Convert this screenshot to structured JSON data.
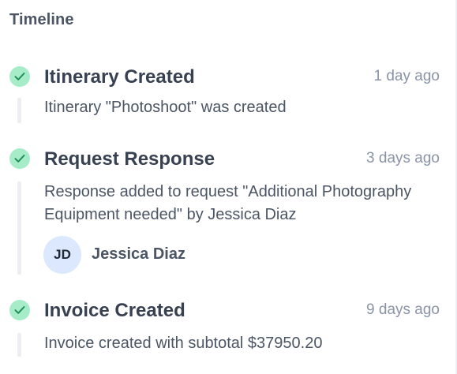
{
  "timeline": {
    "title": "Timeline",
    "status_color": "#a7ecc8",
    "check_color": "#1f8f5a",
    "events": [
      {
        "icon": "check-circle-icon",
        "title": "Itinerary Created",
        "time": "1 day ago",
        "description": "Itinerary \"Photoshoot\" was created"
      },
      {
        "icon": "check-circle-icon",
        "title": "Request Response",
        "time": "3 days ago",
        "description": "Response added to request \"Additional Photography Equipment needed\" by Jessica Diaz",
        "user": {
          "initials": "JD",
          "name": "Jessica Diaz"
        }
      },
      {
        "icon": "check-circle-icon",
        "title": "Invoice Created",
        "time": "9 days ago",
        "description": "Invoice created with subtotal $37950.20"
      }
    ]
  }
}
